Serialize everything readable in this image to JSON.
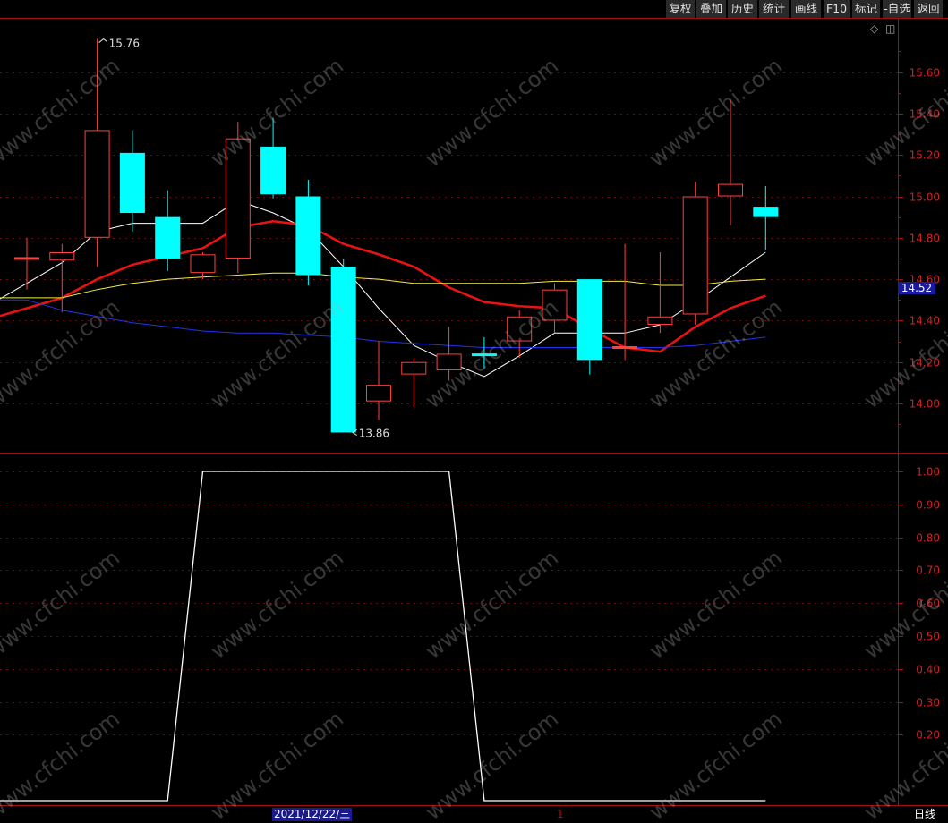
{
  "toolbar": {
    "items": [
      "复权",
      "叠加",
      "历史",
      "统计",
      "画线",
      "F10",
      "标记",
      "-自选",
      "返回"
    ]
  },
  "watermark": "www.cfchi.com",
  "colors": {
    "up": "#ff4040",
    "down": "#00ffff",
    "ma_white": "#ffffff",
    "ma_red": "#ee1111",
    "ma_yellow": "#eeee44",
    "ma_blue": "#2233ee",
    "axis": "#a01010",
    "grid": "#6a0a0a",
    "price_tag_bg": "#1a1aa0"
  },
  "icons": {
    "diamond": "◇",
    "panel": "◫"
  },
  "status": {
    "date": "2021/12/22/三",
    "cursor": "1",
    "period": "日线"
  },
  "chart_data": [
    {
      "type": "candlestick",
      "yticks": [
        "14.00",
        "14.20",
        "14.40",
        "14.60",
        "14.80",
        "15.00",
        "15.20",
        "15.40",
        "15.60"
      ],
      "ylim": [
        13.78,
        15.75
      ],
      "last_price": "14.52",
      "annotations": {
        "high": "15.76",
        "low": "13.86"
      },
      "candles": [
        {
          "o": 14.7,
          "h": 14.8,
          "l": 14.55,
          "c": 14.7
        },
        {
          "o": 14.69,
          "h": 14.77,
          "l": 14.44,
          "c": 14.73
        },
        {
          "o": 14.8,
          "h": 15.76,
          "l": 14.66,
          "c": 15.32
        },
        {
          "o": 15.21,
          "h": 15.32,
          "l": 14.83,
          "c": 14.92
        },
        {
          "o": 14.9,
          "h": 15.03,
          "l": 14.64,
          "c": 14.7
        },
        {
          "o": 14.63,
          "h": 14.73,
          "l": 14.6,
          "c": 14.72
        },
        {
          "o": 14.7,
          "h": 15.36,
          "l": 14.63,
          "c": 15.28
        },
        {
          "o": 15.24,
          "h": 15.38,
          "l": 14.99,
          "c": 15.01
        },
        {
          "o": 15.0,
          "h": 15.08,
          "l": 14.57,
          "c": 14.62
        },
        {
          "o": 14.66,
          "h": 14.7,
          "l": 13.86,
          "c": 13.86
        },
        {
          "o": 14.01,
          "h": 14.3,
          "l": 13.92,
          "c": 14.09
        },
        {
          "o": 14.14,
          "h": 14.22,
          "l": 13.98,
          "c": 14.2
        },
        {
          "o": 14.16,
          "h": 14.37,
          "l": 14.11,
          "c": 14.24
        },
        {
          "o": 14.24,
          "h": 14.32,
          "l": 14.17,
          "c": 14.23
        },
        {
          "o": 14.3,
          "h": 14.45,
          "l": 14.22,
          "c": 14.42
        },
        {
          "o": 14.4,
          "h": 14.58,
          "l": 14.34,
          "c": 14.55
        },
        {
          "o": 14.6,
          "h": 14.6,
          "l": 14.14,
          "c": 14.21
        },
        {
          "o": 14.27,
          "h": 14.77,
          "l": 14.21,
          "c": 14.27
        },
        {
          "o": 14.38,
          "h": 14.73,
          "l": 14.34,
          "c": 14.42
        },
        {
          "o": 14.43,
          "h": 15.07,
          "l": 14.38,
          "c": 15.0
        },
        {
          "o": 15.0,
          "h": 15.47,
          "l": 14.86,
          "c": 15.06
        },
        {
          "o": 14.95,
          "h": 15.05,
          "l": 14.74,
          "c": 14.9
        }
      ],
      "series": [
        {
          "key": "ma_white",
          "values": [
            14.58,
            14.68,
            14.83,
            14.87,
            14.87,
            14.87,
            14.98,
            14.92,
            14.84,
            14.66,
            14.46,
            14.28,
            14.2,
            14.13,
            14.23,
            14.34,
            14.34,
            14.34,
            14.38,
            14.49,
            14.61,
            14.73
          ]
        },
        {
          "key": "ma_red",
          "values": [
            14.46,
            14.51,
            14.6,
            14.67,
            14.71,
            14.75,
            14.85,
            14.88,
            14.86,
            14.77,
            14.72,
            14.66,
            14.56,
            14.49,
            14.47,
            14.46,
            14.36,
            14.27,
            14.25,
            14.37,
            14.46,
            14.52
          ]
        },
        {
          "key": "ma_yellow",
          "values": [
            14.51,
            14.51,
            14.55,
            14.58,
            14.6,
            14.61,
            14.62,
            14.63,
            14.63,
            14.61,
            14.6,
            14.58,
            14.58,
            14.58,
            14.58,
            14.59,
            14.59,
            14.59,
            14.57,
            14.57,
            14.59,
            14.6
          ]
        },
        {
          "key": "ma_blue",
          "values": [
            14.5,
            14.45,
            14.42,
            14.39,
            14.37,
            14.35,
            14.34,
            14.34,
            14.33,
            14.32,
            14.3,
            14.29,
            14.28,
            14.27,
            14.27,
            14.27,
            14.27,
            14.27,
            14.27,
            14.28,
            14.3,
            14.32
          ]
        }
      ]
    },
    {
      "type": "line",
      "yticks": [
        "0.20",
        "0.30",
        "0.40",
        "0.50",
        "0.60",
        "0.70",
        "0.80",
        "0.90",
        "1.00"
      ],
      "ylim": [
        -0.02,
        1.06
      ],
      "values": [
        0,
        0,
        0,
        0,
        0,
        1,
        1,
        1,
        1,
        1,
        1,
        1,
        1,
        0,
        0,
        0,
        0,
        0,
        0,
        0,
        0,
        0
      ]
    }
  ]
}
